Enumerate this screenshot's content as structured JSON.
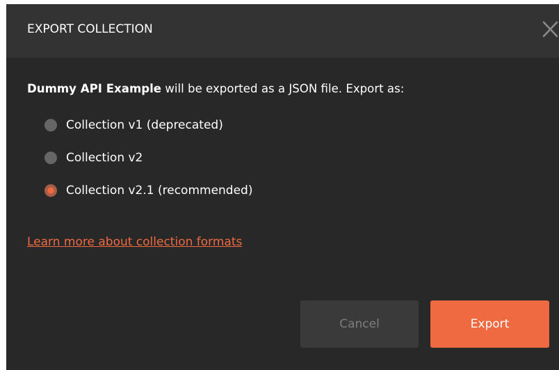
{
  "dialog": {
    "title": "EXPORT COLLECTION",
    "prompt": {
      "collection_name": "Dummy API Example",
      "text": " will be exported as a JSON file. Export as:"
    },
    "options": [
      {
        "label": "Collection v1 (deprecated)",
        "selected": false
      },
      {
        "label": "Collection v2",
        "selected": false
      },
      {
        "label": "Collection v2.1 (recommended)",
        "selected": true
      }
    ],
    "learn_more_link": "Learn more about collection formats",
    "buttons": {
      "cancel": "Cancel",
      "export": "Export"
    },
    "icons": {
      "close": "close-icon"
    },
    "colors": {
      "accent": "#ef6a41",
      "background": "#282828",
      "header": "#333333"
    }
  }
}
